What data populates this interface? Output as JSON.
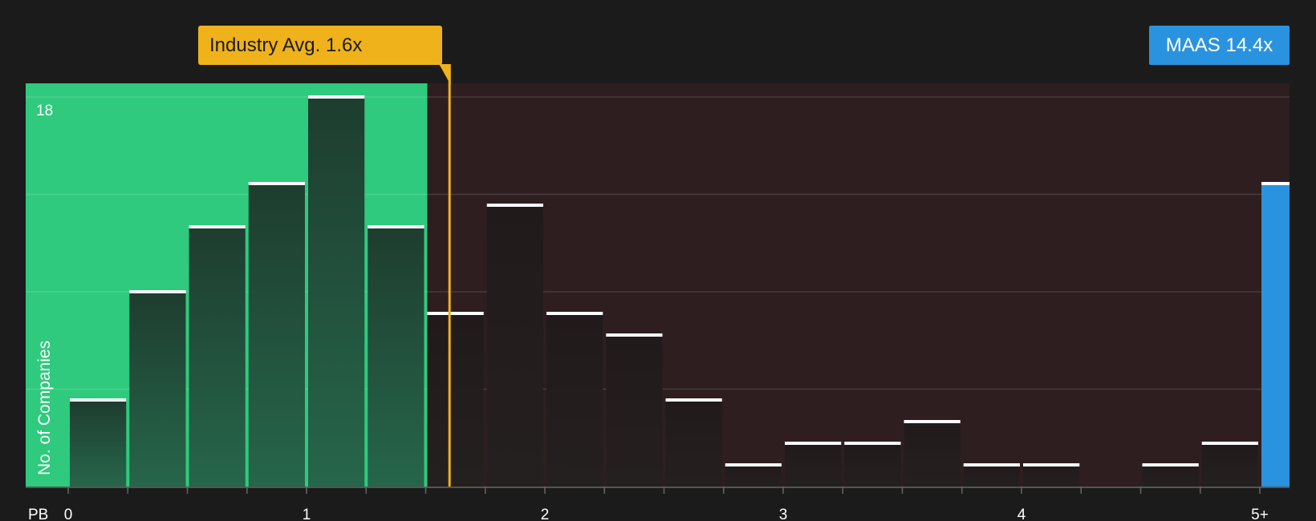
{
  "chart_data": {
    "type": "bar",
    "xlabel": "PB",
    "ylabel": "No. of Companies",
    "y_max_label": "18",
    "ylim": [
      0,
      18
    ],
    "x_ticks": [
      "0",
      "1",
      "2",
      "3",
      "4",
      "5+"
    ],
    "bin_width": 0.25,
    "bins": [
      {
        "start": 0.0,
        "value": 4
      },
      {
        "start": 0.25,
        "value": 9
      },
      {
        "start": 0.5,
        "value": 12
      },
      {
        "start": 0.75,
        "value": 14
      },
      {
        "start": 1.0,
        "value": 18
      },
      {
        "start": 1.25,
        "value": 12
      },
      {
        "start": 1.5,
        "value": 8
      },
      {
        "start": 1.75,
        "value": 13
      },
      {
        "start": 2.0,
        "value": 8
      },
      {
        "start": 2.25,
        "value": 7
      },
      {
        "start": 2.5,
        "value": 4
      },
      {
        "start": 2.75,
        "value": 1
      },
      {
        "start": 3.0,
        "value": 2
      },
      {
        "start": 3.25,
        "value": 2
      },
      {
        "start": 3.5,
        "value": 3
      },
      {
        "start": 3.75,
        "value": 1
      },
      {
        "start": 4.0,
        "value": 1
      },
      {
        "start": 4.25,
        "value": 0
      },
      {
        "start": 4.5,
        "value": 1
      },
      {
        "start": 4.75,
        "value": 2
      }
    ],
    "company_bar_value": 14,
    "industry_average": {
      "value": 1.6,
      "label": "Industry Avg. 1.6x"
    },
    "company": {
      "ticker": "MAAS",
      "value": 14.4,
      "label": "MAAS 14.4x"
    },
    "fair_region_end": 1.5,
    "colors": {
      "background": "#1b1b1b",
      "fair_region": "#2fca7d",
      "expensive_region": "#2e1e1f",
      "bar_fair": "#1f3a2e",
      "bar_expensive": "#221b1c",
      "bar_top": "#ffffff",
      "average_line": "#efb21b",
      "company_bar": "#2a93e0"
    }
  }
}
